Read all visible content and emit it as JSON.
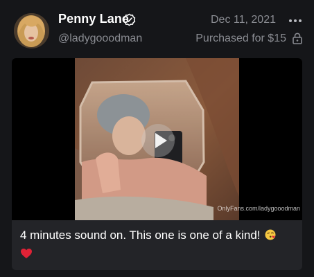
{
  "post": {
    "author": {
      "display_name": "Penny Lane",
      "handle": "@ladygooodman",
      "verified": true
    },
    "date": "Dec 11, 2021",
    "purchase_status": "Purchased for $15",
    "media": {
      "type": "video",
      "watermark": "OnlyFans.com/ladygooodman"
    },
    "caption": "4 minutes sound on. This one is one of a kind!",
    "caption_emojis": [
      "kissing-face-emoji",
      "red-heart-emoji"
    ]
  },
  "icons": [
    "verified-icon",
    "more-icon",
    "lock-icon",
    "play-icon"
  ],
  "colors": {
    "background": "#151619",
    "card": "#232428",
    "muted_text": "#8a8c92",
    "primary_text": "#ffffff"
  }
}
